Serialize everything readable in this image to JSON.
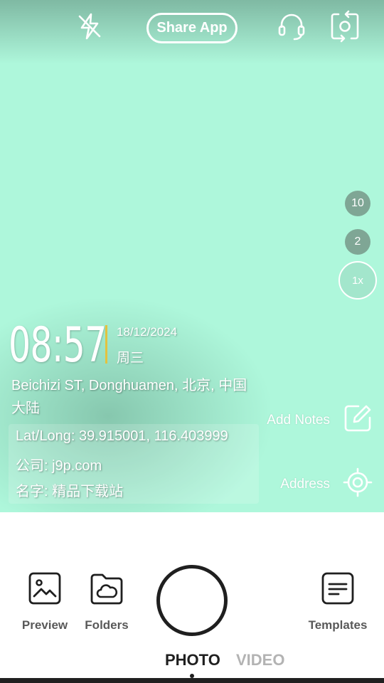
{
  "top_bar": {
    "flash_icon": "flash-off-icon",
    "share_label": "Share App",
    "support_icon": "headset-icon",
    "switch_icon": "camera-switch-icon"
  },
  "zoom": {
    "options": [
      "10",
      "2",
      "1x"
    ],
    "selected": "1x"
  },
  "watermark": {
    "time": "08:57",
    "date": "18/12/2024",
    "weekday": "周三",
    "address": "Beichizi ST, Donghuamen, 北京, 中国大陆",
    "latlong": "Lat/Long: 39.915001, 116.403999",
    "company": "公司: j9p.com",
    "name": "名字: 精品下载站",
    "accent_color": "#e3c23f"
  },
  "side_actions": {
    "notes_label": "Add Notes",
    "notes_icon": "edit-note-icon",
    "address_label": "Address",
    "address_icon": "location-target-icon"
  },
  "bottom": {
    "preview_label": "Preview",
    "folders_label": "Folders",
    "templates_label": "Templates",
    "modes": [
      "PHOTO",
      "VIDEO"
    ],
    "active_mode": "PHOTO"
  },
  "colors": {
    "viewfinder_bg": "#aef7db",
    "zoom_bg": "#7fa695"
  }
}
